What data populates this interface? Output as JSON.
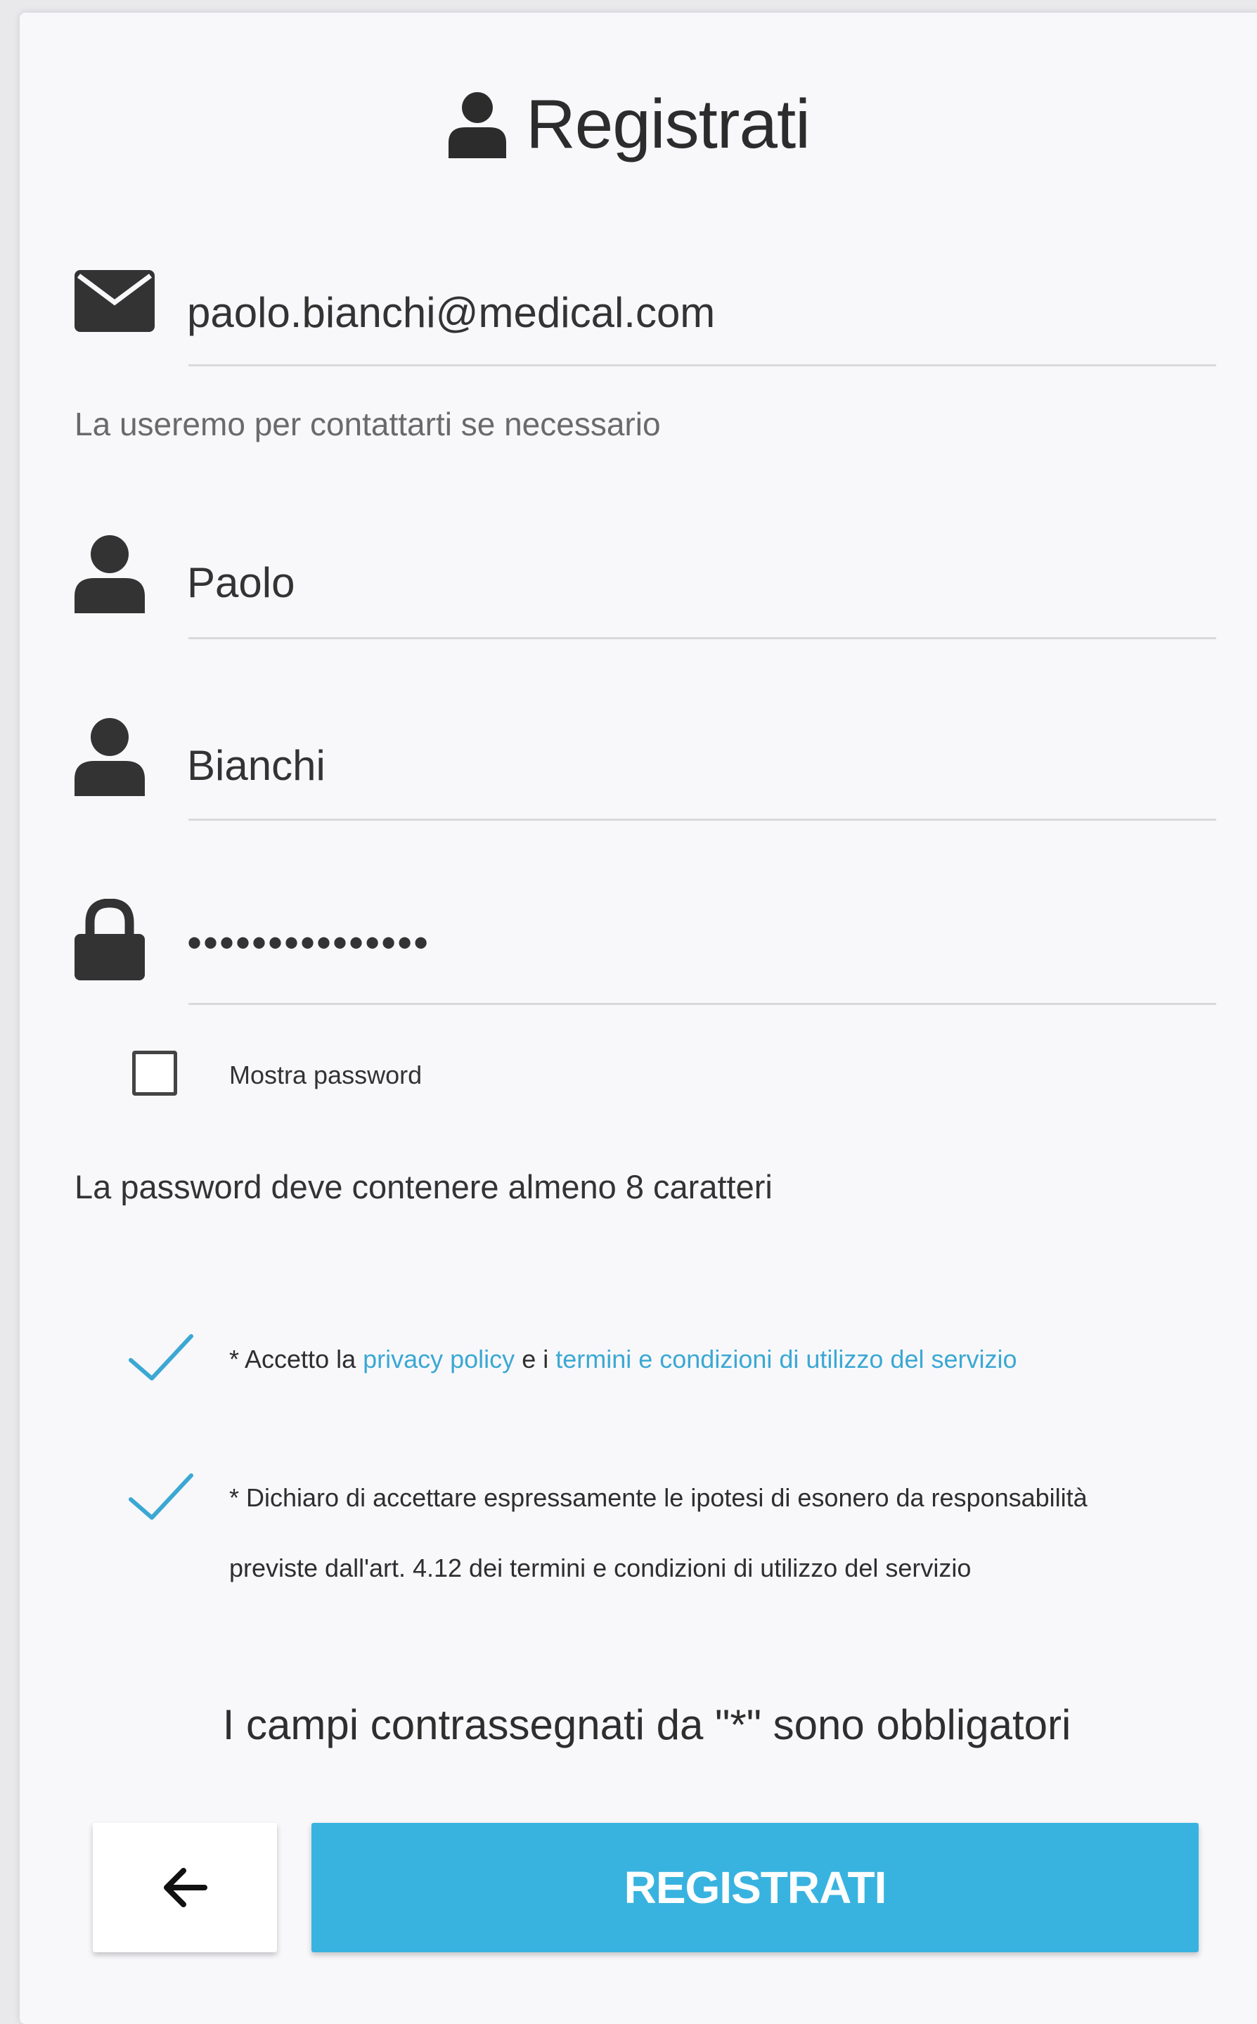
{
  "header": {
    "title": "Registrati",
    "icon": "user-icon"
  },
  "email": {
    "value": "paolo.bianchi@medical.com",
    "hint": "La useremo per contattarti se necessario",
    "icon": "envelope-icon"
  },
  "first_name": {
    "value": "Paolo",
    "icon": "user-icon"
  },
  "last_name": {
    "value": "Bianchi",
    "icon": "user-icon"
  },
  "password": {
    "value": "•••••••••••••••",
    "icon": "lock-icon"
  },
  "show_password": {
    "label": "Mostra password",
    "checked": false
  },
  "password_rule": "La password deve contenere almeno 8 caratteri",
  "consent_privacy": {
    "prefix": "* Accetto la ",
    "privacy_link": "privacy policy",
    "middle": " e i ",
    "terms_link": "termini e condizioni di utilizzo del servizio",
    "checked": true
  },
  "consent_liability": {
    "line1": "* Dichiaro di accettare espressamente le ipotesi di esonero da responsabilità",
    "line2": "previste dall'art. 4.12 dei termini e condizioni di utilizzo del servizio",
    "checked": true
  },
  "required_note": "I campi contrassegnati da \"*\" sono obbligatori",
  "buttons": {
    "back_icon": "arrow-left-icon",
    "submit_label": "REGISTRATI"
  },
  "colors": {
    "accent": "#38b3e0",
    "link": "#3ba8d3",
    "check": "#3ba8d3"
  }
}
